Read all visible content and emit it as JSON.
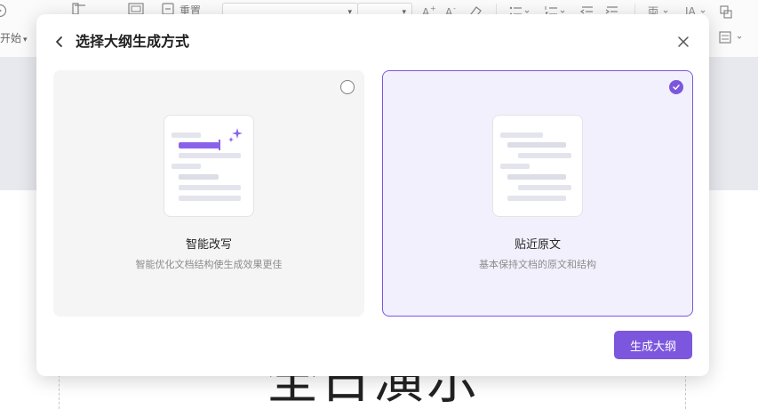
{
  "background": {
    "toolbar": {
      "start_label": "开始",
      "tab_label_1": "重置"
    },
    "slide": {
      "title_text": "全日演示"
    }
  },
  "modal": {
    "title": "选择大纲生成方式",
    "back_icon": "chevron-left-icon",
    "close_icon": "close-icon",
    "options": [
      {
        "title": "智能改写",
        "description": "智能优化文档结构使生成效果更佳",
        "selected": false
      },
      {
        "title": "贴近原文",
        "description": "基本保持文档的原文和结构",
        "selected": true
      }
    ],
    "primary_button": "生成大纲"
  },
  "colors": {
    "accent": "#7c57dd",
    "selected_card_bg": "#f3f0fd",
    "unselected_card_bg": "#f5f5f5"
  }
}
